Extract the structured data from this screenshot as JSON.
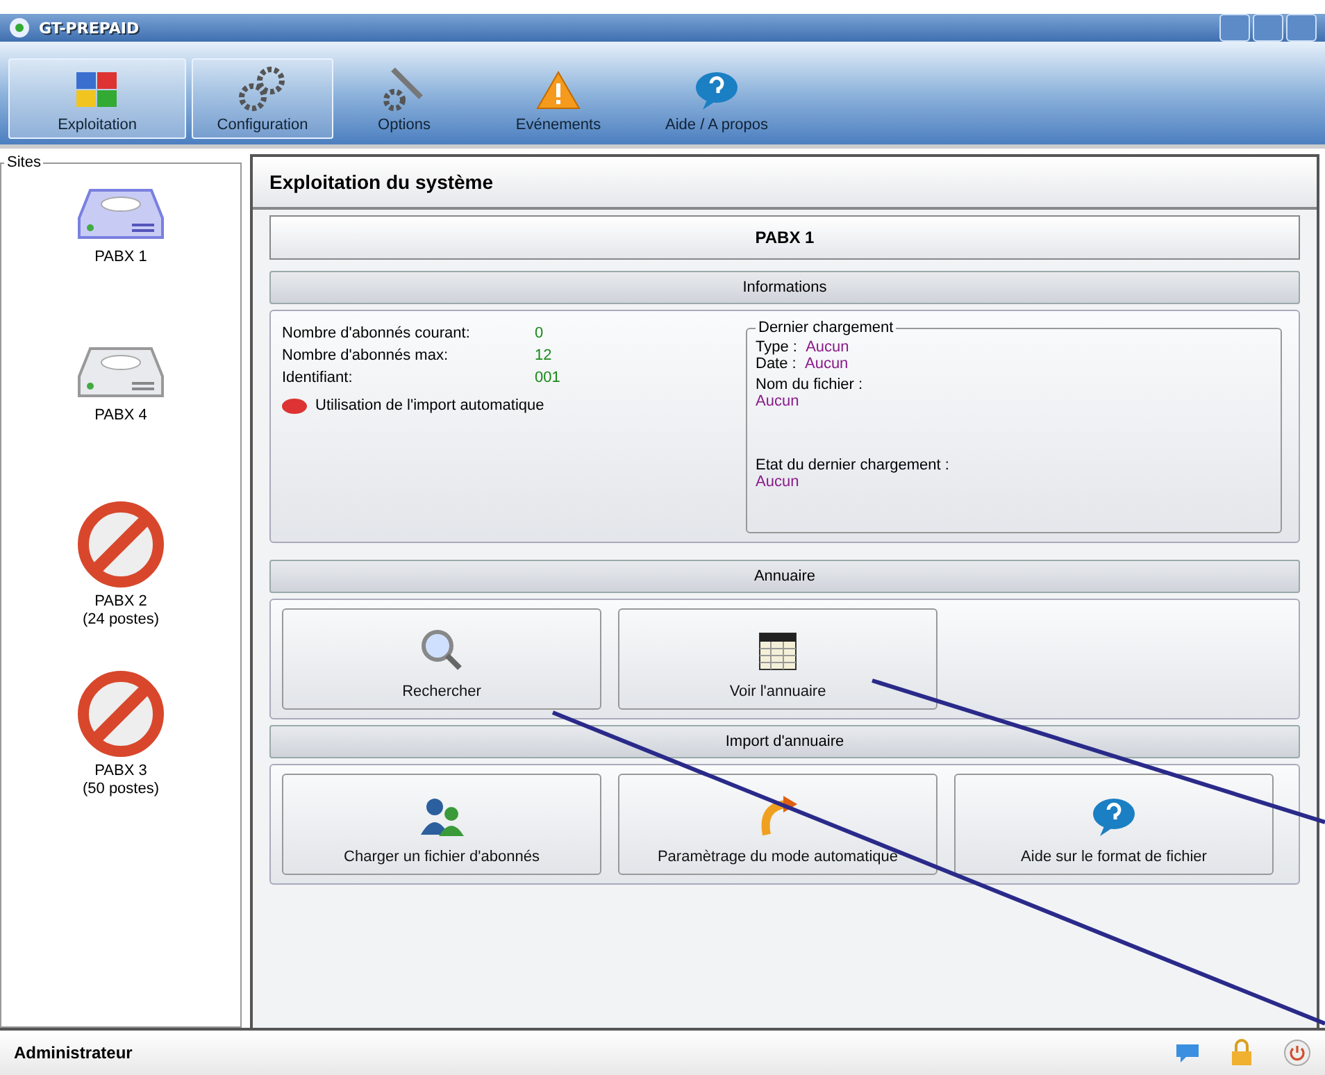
{
  "window": {
    "title": "GT-PREPAID"
  },
  "toolbar": [
    {
      "label": "Exploitation",
      "selected": true,
      "hovered": false
    },
    {
      "label": "Configuration",
      "selected": false,
      "hovered": true
    },
    {
      "label": "Options",
      "selected": false,
      "hovered": false
    },
    {
      "label": "Evénements",
      "selected": false,
      "hovered": false
    },
    {
      "label": "Aide / A propos",
      "selected": false,
      "hovered": false
    }
  ],
  "sidebar": {
    "title": "Sites",
    "items": [
      {
        "name": "PABX 1",
        "kind": "drive",
        "selected": true
      },
      {
        "name": "PABX 4",
        "kind": "drive",
        "selected": false
      },
      {
        "name": "PABX 2",
        "detail": "(24 postes)",
        "kind": "blocked",
        "selected": false
      },
      {
        "name": "PABX 3",
        "detail": "(50 postes)",
        "kind": "blocked",
        "selected": false
      }
    ]
  },
  "main": {
    "title": "Exploitation du système",
    "site_title": "PABX 1",
    "informations": {
      "title": "Informations",
      "rows": [
        {
          "label": "Nombre d'abonnés courant:",
          "value": "0"
        },
        {
          "label": "Nombre d'abonnés max:",
          "value": "12"
        },
        {
          "label": "Identifiant:",
          "value": "001"
        }
      ],
      "auto_import": {
        "label": "Utilisation de l'import automatique",
        "on": false
      },
      "last_load": {
        "title": "Dernier chargement",
        "type_label": "Type :",
        "type_value": "Aucun",
        "date_label": "Date :",
        "date_value": "Aucun",
        "file_label": "Nom du fichier :",
        "file_value": "Aucun",
        "state_label": "Etat du dernier chargement :",
        "state_value": "Aucun"
      }
    },
    "sections": [
      {
        "title": "Annuaire",
        "buttons": [
          {
            "label": "Rechercher"
          },
          {
            "label": "Voir l'annuaire"
          }
        ]
      },
      {
        "title": "Import d'annuaire",
        "buttons": [
          {
            "label": "Charger un fichier d'abonnés"
          },
          {
            "label": "Paramètrage du mode automatique"
          },
          {
            "label": "Aide sur le format de fichier"
          }
        ]
      }
    ]
  },
  "status_bar": {
    "user": "Administrateur"
  }
}
